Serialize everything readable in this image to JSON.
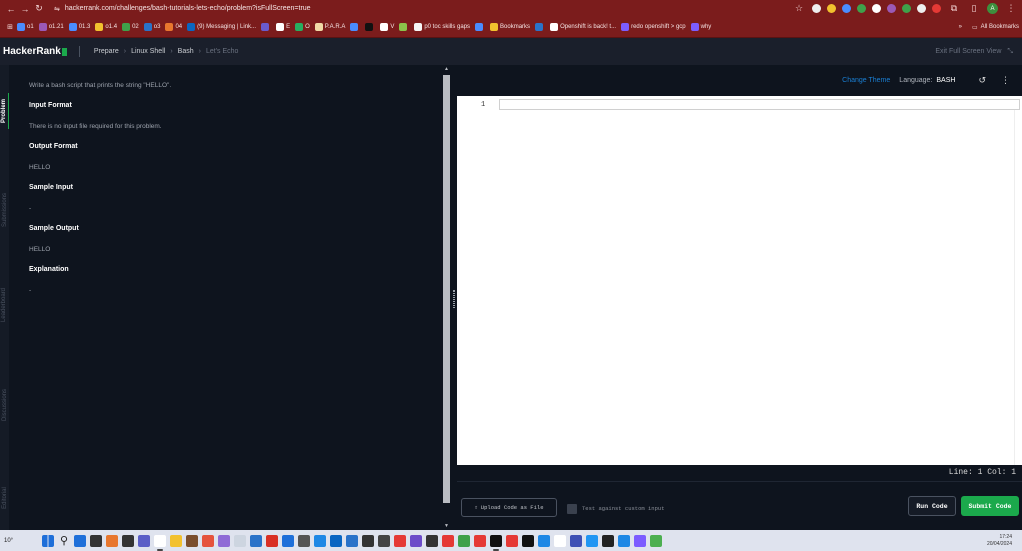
{
  "browser": {
    "url": "hackerrank.com/challenges/bash-tutorials-lets-echo/problem?isFullScreen=true",
    "bookmarks": [
      {
        "label": "o1",
        "color": "#4a8cff"
      },
      {
        "label": "o1.21",
        "color": "#9b59b6"
      },
      {
        "label": "01.3",
        "color": "#4a8cff"
      },
      {
        "label": "o1.4",
        "color": "#f2c12e"
      },
      {
        "label": "02",
        "color": "#3fa14a"
      },
      {
        "label": "o3",
        "color": "#2a73c9"
      },
      {
        "label": "04",
        "color": "#e8772e"
      },
      {
        "label": "(9) Messaging | Link...",
        "color": "#0a66c2"
      },
      {
        "label": "",
        "color": "#6a5acd"
      },
      {
        "label": "E",
        "color": "#ffffff"
      },
      {
        "label": "O",
        "color": "#27ae60"
      },
      {
        "label": "P.A.R.A",
        "color": "#f0d9a6"
      },
      {
        "label": "",
        "color": "#4a8cff"
      },
      {
        "label": "",
        "color": "#111111"
      },
      {
        "label": "V",
        "color": "#ffffff"
      },
      {
        "label": "",
        "color": "#8bc34a"
      },
      {
        "label": "p0 toc skills gaps",
        "color": "#f5f5f5"
      },
      {
        "label": "",
        "color": "#4a8cff"
      },
      {
        "label": "Bookmarks",
        "color": "#f2c12e"
      },
      {
        "label": "",
        "color": "#2a73c9"
      },
      {
        "label": "Openshift is back! t...",
        "color": "#ffffff"
      },
      {
        "label": "redo openshift > gcp",
        "color": "#7c5cff"
      },
      {
        "label": "why",
        "color": "#7c5cff"
      }
    ],
    "more_label": "»",
    "all_bookmarks": "All Bookmarks",
    "profile_initial": "A"
  },
  "header": {
    "logo": "HackerRank",
    "breadcrumbs": [
      "Prepare",
      "Linux Shell",
      "Bash"
    ],
    "current": "Let's Echo",
    "exit_fullscreen": "Exit Full Screen View"
  },
  "side_tabs": [
    "Problem",
    "Submissions",
    "Leaderboard",
    "Discussions",
    "Editorial"
  ],
  "problem": {
    "statement": "Write a bash script that prints the string \"HELLO\".",
    "input_format_title": "Input Format",
    "input_format": "There is no input file required for this problem.",
    "output_format_title": "Output Format",
    "output_format": "HELLO",
    "sample_input_title": "Sample Input",
    "sample_input": "-",
    "sample_output_title": "Sample Output",
    "sample_output": "HELLO",
    "explanation_title": "Explanation",
    "explanation": "-"
  },
  "editor": {
    "change_theme": "Change Theme",
    "language_label": "Language:",
    "language": "BASH",
    "line_number": "1",
    "status": "Line: 1 Col: 1",
    "upload": "Upload Code as File",
    "custom_input": "Test against custom input",
    "run": "Run Code",
    "submit": "Submit Code"
  },
  "taskbar": {
    "weather": "10°",
    "time": "17:24",
    "date": "20/04/2024",
    "icon_colors": [
      "#1e6fd9",
      "#333333",
      "#e8772e",
      "#333333",
      "#5b5fc7",
      "#ffffff",
      "#f2c12e",
      "#7a4e2d",
      "#e5533d",
      "#8f6bd6",
      "#cdd5e0",
      "#2a73c9",
      "#d93025",
      "#1e6fd9",
      "#555555",
      "#1e88e5",
      "#0a66c2",
      "#2a73c9",
      "#333333",
      "#444444",
      "#e53935",
      "#6c4cc9",
      "#333333",
      "#e53935",
      "#3fa14a",
      "#e53935",
      "#111111",
      "#e53935",
      "#111111",
      "#1e88e5",
      "#ffffff",
      "#3f51b5",
      "#2196f3",
      "#222222",
      "#1e88e5",
      "#7c5cff",
      "#4caf50"
    ]
  }
}
